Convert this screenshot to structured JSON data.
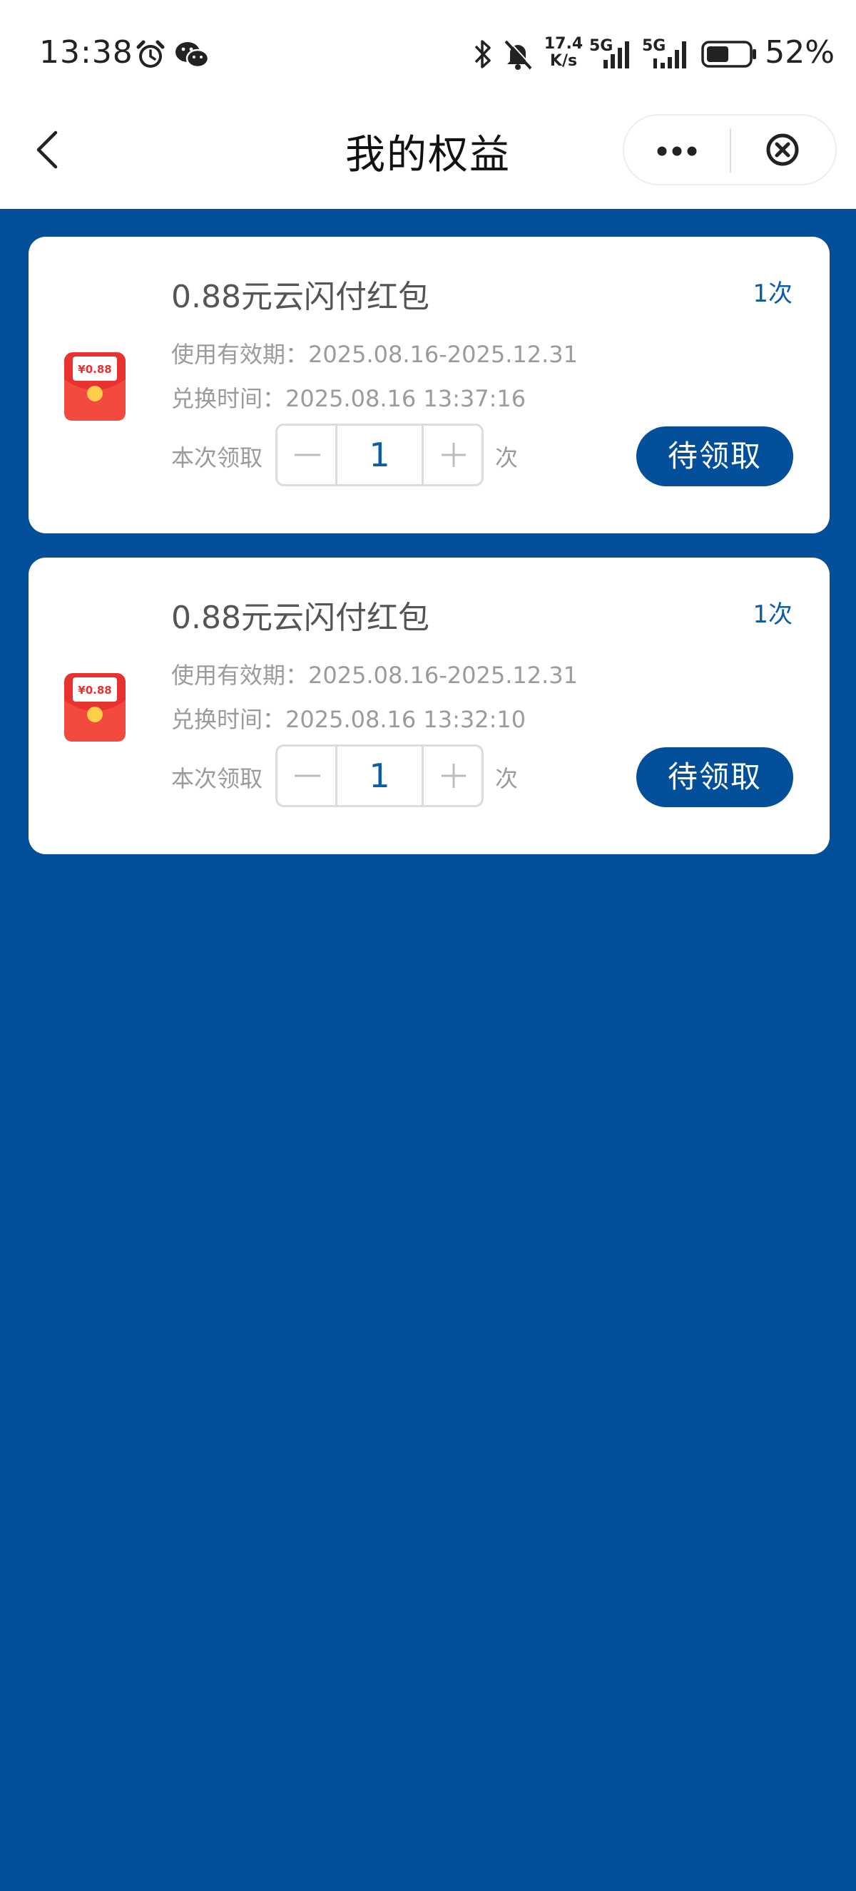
{
  "status_bar": {
    "time": "13:38",
    "net_speed_value": "17.4",
    "net_speed_unit": "K/s",
    "signal_1": "5G",
    "signal_2": "5G",
    "battery": "52%",
    "icons": [
      "alarm-icon",
      "wechat-icon",
      "bluetooth-icon",
      "mute-icon",
      "signal-icon",
      "battery-icon"
    ]
  },
  "nav": {
    "title": "我的权益",
    "back_icon": "chevron-left-icon",
    "more_icon": "more-dots-icon",
    "close_icon": "close-circle-icon"
  },
  "cards": [
    {
      "title": "0.88元云闪付红包",
      "count": "1次",
      "validity": "使用有效期：2025.08.16-2025.12.31",
      "exchange_time": "兑换时间：2025.08.16 13:37:16",
      "claim_label": "本次领取",
      "quantity": "1",
      "unit": "次",
      "button": "待领取",
      "icon_text": "¥0.88"
    },
    {
      "title": "0.88元云闪付红包",
      "count": "1次",
      "validity": "使用有效期：2025.08.16-2025.12.31",
      "exchange_time": "兑换时间：2025.08.16 13:32:10",
      "claim_label": "本次领取",
      "quantity": "1",
      "unit": "次",
      "button": "待领取",
      "icon_text": "¥0.88"
    }
  ],
  "colors": {
    "brand_blue": "#034f99",
    "accent_text": "#0d5ca8",
    "red_packet": "#e8322f"
  }
}
